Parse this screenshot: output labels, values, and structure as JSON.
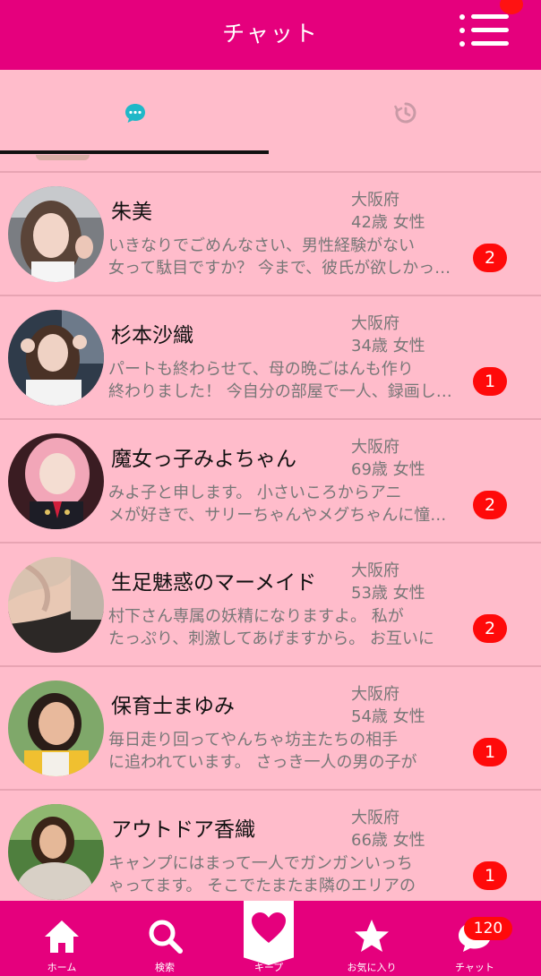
{
  "header": {
    "title": "チャット"
  },
  "tabs": [
    {
      "icon": "chat-bubble-icon",
      "active": true
    },
    {
      "icon": "history-clock-icon",
      "active": false
    }
  ],
  "chats": [
    {
      "name": "朱美",
      "prefecture": "大阪府",
      "age": "42歳",
      "gender": "女性",
      "message_line1": "いきなりでごめんなさい、男性経験がない",
      "message_line2": "女って駄目ですか？ 今まで、彼氏が欲しかったんですけど",
      "unread": "2"
    },
    {
      "name": "杉本沙織",
      "prefecture": "大阪府",
      "age": "34歳",
      "gender": "女性",
      "message_line1": "パートも終わらせて、母の晩ごはんも作り",
      "message_line2": "終わりました！ 今自分の部屋で一人、録画したドラマを",
      "unread": "1"
    },
    {
      "name": "魔女っ子みよちゃん",
      "prefecture": "大阪府",
      "age": "69歳",
      "gender": "女性",
      "message_line1": "みよ子と申します。 小さいころからアニ",
      "message_line2": "メが好きで、サリーちゃんやメグちゃんに憧れて",
      "unread": "2"
    },
    {
      "name": "生足魅惑のマーメイド",
      "prefecture": "大阪府",
      "age": "53歳",
      "gender": "女性",
      "message_line1": "村下さん専属の妖精になりますよ。 私が",
      "message_line2": "たっぷり、刺激してあげますから。 お互いに",
      "unread": "2"
    },
    {
      "name": "保育士まゆみ",
      "prefecture": "大阪府",
      "age": "54歳",
      "gender": "女性",
      "message_line1": "毎日走り回ってやんちゃ坊主たちの相手",
      "message_line2": "に追われています。 さっき一人の男の子が",
      "unread": "1"
    },
    {
      "name": "アウトドア香織",
      "prefecture": "大阪府",
      "age": "66歳",
      "gender": "女性",
      "message_line1": "キャンプにはまって一人でガンガンいっち",
      "message_line2": "ゃってます。 そこでたまたま隣のエリアの",
      "unread": "1"
    }
  ],
  "bottom_nav": [
    {
      "label": "ホーム",
      "icon": "home-icon"
    },
    {
      "label": "検索",
      "icon": "search-icon"
    },
    {
      "label": "キープ",
      "icon": "heart-icon"
    },
    {
      "label": "お気に入り",
      "icon": "star-icon"
    },
    {
      "label": "チャット",
      "icon": "chat-icon",
      "badge": "120"
    }
  ],
  "colors": {
    "brand": "#e5007d",
    "background": "#ffbccb",
    "badge": "#ff0a0a",
    "tab_icon": "#1fb8c8"
  }
}
